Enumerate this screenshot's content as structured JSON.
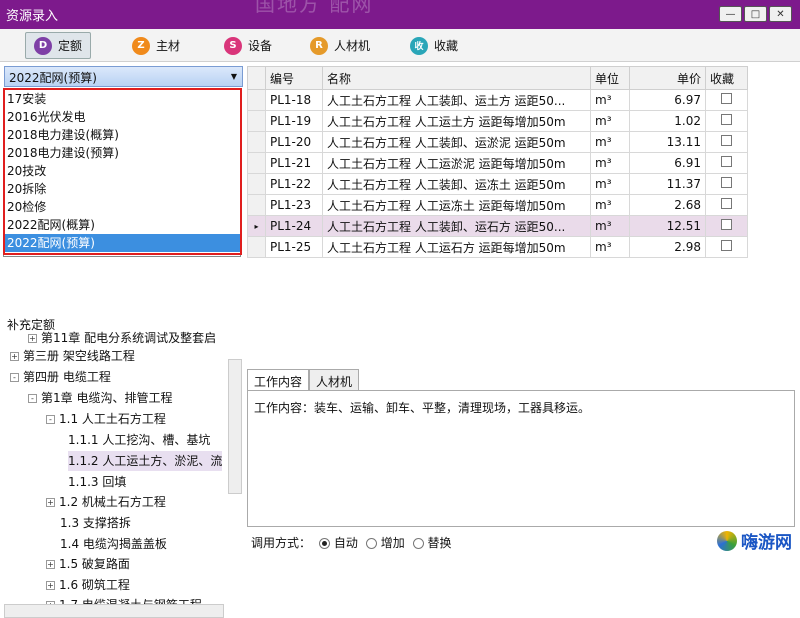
{
  "window": {
    "title": "资源录入",
    "ghost_text": "国地方 配网",
    "btn_min": "—",
    "btn_max": "□",
    "btn_close": "✕"
  },
  "toolbar": {
    "items": [
      {
        "icon_letter": "D",
        "label": "定额",
        "color": "#7e3fa6"
      },
      {
        "icon_letter": "Z",
        "label": "主材",
        "color": "#f08a1c"
      },
      {
        "icon_letter": "S",
        "label": "设备",
        "color": "#d9357a"
      },
      {
        "icon_letter": "R",
        "label": "人材机",
        "color": "#e59a2a"
      },
      {
        "icon_letter": "收",
        "label": "收藏",
        "color": "#2aa6b8"
      }
    ]
  },
  "combo": {
    "value": "2022配网(预算)",
    "arrow": "▼"
  },
  "dropdown": {
    "options": [
      "17安装",
      "2016光伏发电",
      "2018电力建设(概算)",
      "2018电力建设(预算)",
      "20技改",
      "20拆除",
      "20检修",
      "2022配网(概算)",
      "2022配网(预算)"
    ],
    "selected": "2022配网(预算)"
  },
  "supplement": "补充定额",
  "tree": [
    {
      "label": "第11章 配电分系统调试及整套启",
      "indent": 28,
      "toggle": "+"
    },
    {
      "label": "第三册 架空线路工程",
      "indent": 10,
      "toggle": "+"
    },
    {
      "label": "第四册 电缆工程",
      "indent": 10,
      "toggle": "-"
    },
    {
      "label": "第1章 电缆沟、排管工程",
      "indent": 28,
      "toggle": "-"
    },
    {
      "label": "1.1 人工土石方工程",
      "indent": 46,
      "toggle": "-"
    },
    {
      "label": "1.1.1 人工挖沟、槽、基坑",
      "indent": 66,
      "toggle": ""
    },
    {
      "label": "1.1.2 人工运土方、淤泥、流",
      "indent": 66,
      "toggle": "",
      "hl": true
    },
    {
      "label": "1.1.3 回填",
      "indent": 66,
      "toggle": ""
    },
    {
      "label": "1.2 机械土石方工程",
      "indent": 46,
      "toggle": "+"
    },
    {
      "label": "1.3 支撑搭拆",
      "indent": 46,
      "toggle": ""
    },
    {
      "label": "1.4 电缆沟揭盖盖板",
      "indent": 46,
      "toggle": ""
    },
    {
      "label": "1.5 破复路面",
      "indent": 46,
      "toggle": "+"
    },
    {
      "label": "1.6 砌筑工程",
      "indent": 46,
      "toggle": "+"
    },
    {
      "label": "1.7 电缆混凝土与钢筋工程",
      "indent": 46,
      "toggle": "+"
    }
  ],
  "grid": {
    "headers": {
      "code": "编号",
      "name": "名称",
      "unit": "单位",
      "price": "单价",
      "fav": "收藏"
    },
    "rows": [
      {
        "code": "PL1-18",
        "name": "人工土石方工程 人工装卸、运土方 运距50...",
        "unit": "m³",
        "price": "6.97"
      },
      {
        "code": "PL1-19",
        "name": "人工土石方工程 人工运土方 运距每增加50m",
        "unit": "m³",
        "price": "1.02"
      },
      {
        "code": "PL1-20",
        "name": "人工土石方工程 人工装卸、运淤泥 运距50m",
        "unit": "m³",
        "price": "13.11"
      },
      {
        "code": "PL1-21",
        "name": "人工土石方工程 人工运淤泥 运距每增加50m",
        "unit": "m³",
        "price": "6.91"
      },
      {
        "code": "PL1-22",
        "name": "人工土石方工程 人工装卸、运冻土 运距50m",
        "unit": "m³",
        "price": "11.37"
      },
      {
        "code": "PL1-23",
        "name": "人工土石方工程 人工运冻土 运距每增加50m",
        "unit": "m³",
        "price": "2.68"
      },
      {
        "code": "PL1-24",
        "name": "人工土石方工程 人工装卸、运石方 运距50...",
        "unit": "m³",
        "price": "12.51",
        "selected": true
      },
      {
        "code": "PL1-25",
        "name": "人工土石方工程 人工运石方 运距每增加50m",
        "unit": "m³",
        "price": "2.98"
      }
    ]
  },
  "tabs": [
    "工作内容",
    "人材机"
  ],
  "work_content": "工作内容：装车、运输、卸车、平整，清理现场，工器具移运。",
  "mode": {
    "label": "调用方式：",
    "options": [
      "自动",
      "增加",
      "替换"
    ],
    "selected": "自动"
  },
  "logo": {
    "text": "嗨游网"
  }
}
